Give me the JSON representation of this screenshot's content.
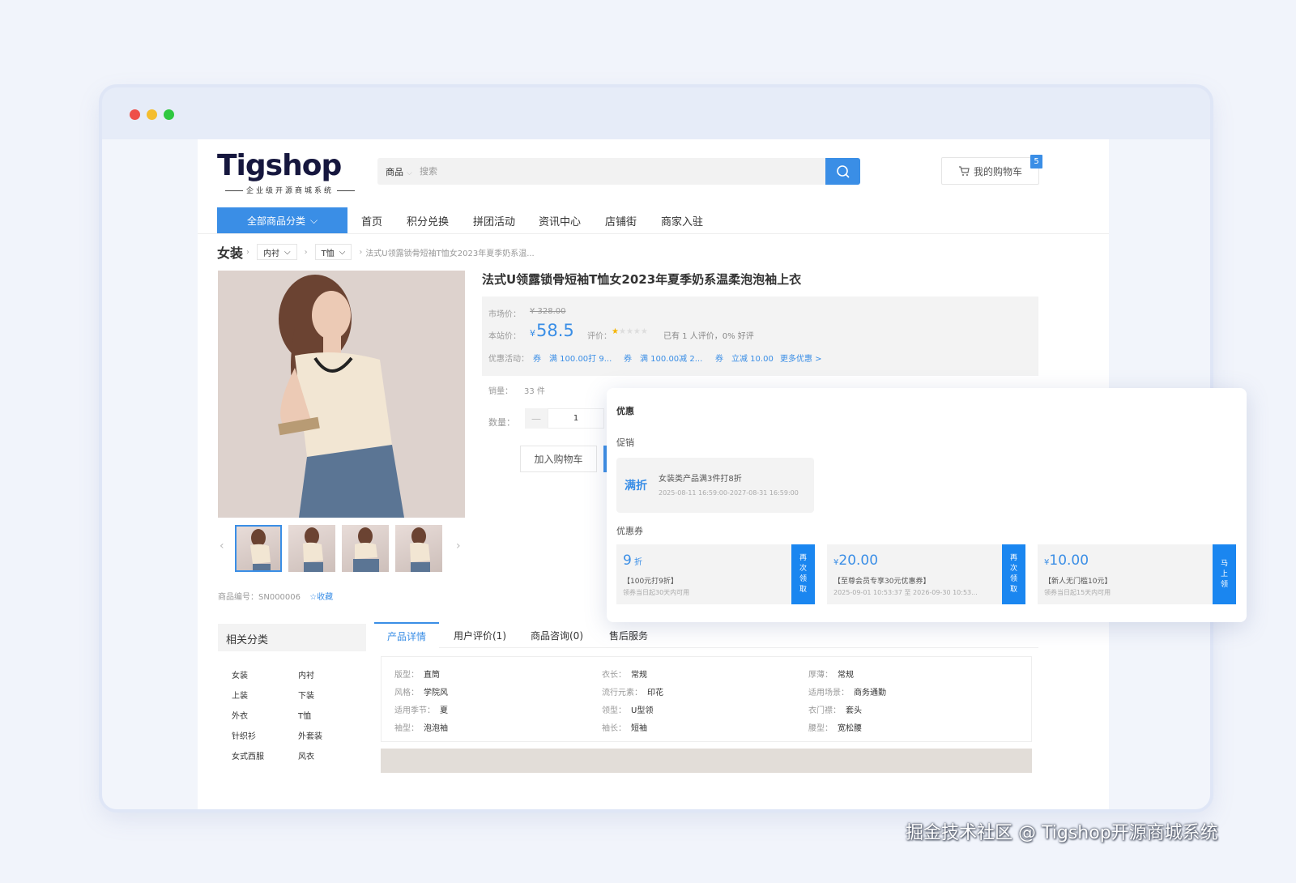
{
  "window": {
    "dots": [
      "#ee4f49",
      "#f4bd2f",
      "#2fc840"
    ]
  },
  "header": {
    "logo": "Tigshop",
    "logo_sub": "企业级开源商城系统",
    "search": {
      "category": "商品",
      "placeholder": "搜索"
    },
    "cart_label": "我的购物车",
    "cart_count": "5"
  },
  "nav": {
    "all_categories": "全部商品分类",
    "items": [
      "首页",
      "积分兑换",
      "拼团活动",
      "资讯中心",
      "店铺街",
      "商家入驻"
    ]
  },
  "breadcrumb": {
    "root": "女装",
    "level1": "内衬",
    "level2": "T恤",
    "current": "法式U领露锁骨短袖T恤女2023年夏季奶系温..."
  },
  "product": {
    "title": "法式U领露锁骨短袖T恤女2023年夏季奶系温柔泡泡袖上衣",
    "market_price_label": "市场价：",
    "market_price": "¥ 328.00",
    "price_label": "本站价：",
    "price_currency": "¥",
    "price": "58.5",
    "rating_label": "评价：",
    "rating_stars": 1,
    "rating_text": "已有 1 人评价，0% 好评",
    "promo_label": "优惠活动：",
    "promos": [
      "券　满 100.00打 9...",
      "券　满 100.00减 2...",
      "券　立减 10.00"
    ],
    "more_promos": "更多优惠 >",
    "sales_label": "销量：",
    "sales": "33 件",
    "qty_label": "数量：",
    "qty": "1",
    "qty_minus": "—",
    "add_cart": "加入购物车",
    "sku_label": "商品编号：",
    "sku": "SN000006",
    "favorite": "收藏"
  },
  "related": {
    "title": "相关分类",
    "items": [
      "女装",
      "内衬",
      "上装",
      "下装",
      "外衣",
      "T恤",
      "针织衫",
      "外套装",
      "女式西服",
      "风衣"
    ]
  },
  "tabs": [
    "产品详情",
    "用户评价(1)",
    "商品咨询(0)",
    "售后服务"
  ],
  "specs": [
    {
      "k": "版型：",
      "v": "直筒"
    },
    {
      "k": "衣长：",
      "v": "常规"
    },
    {
      "k": "厚薄：",
      "v": "常规"
    },
    {
      "k": "风格：",
      "v": "学院风"
    },
    {
      "k": "流行元素：",
      "v": "印花"
    },
    {
      "k": "适用场景：",
      "v": "商务通勤"
    },
    {
      "k": "适用季节：",
      "v": "夏"
    },
    {
      "k": "领型：",
      "v": "U型领"
    },
    {
      "k": "衣门襟：",
      "v": "套头"
    },
    {
      "k": "袖型：",
      "v": "泡泡袖"
    },
    {
      "k": "袖长：",
      "v": "短袖"
    },
    {
      "k": "腰型：",
      "v": "宽松腰"
    }
  ],
  "popup": {
    "title": "优惠",
    "promo_section": "促销",
    "promo": {
      "tag": "满折",
      "text": "女装类产品满3件打8折",
      "date": "2025-08-11 16:59:00-2027-08-31 16:59:00"
    },
    "coupon_section": "优惠券",
    "coupons": [
      {
        "prefix": "",
        "value": "9",
        "unit": " 折",
        "name": "【100元打9折】",
        "note": "领券当日起30天内可用",
        "btn": "再次领取"
      },
      {
        "prefix": "¥",
        "value": "20.00",
        "unit": "",
        "name": "【至尊会员专享30元优惠券】",
        "note": "2025-09-01 10:53:37 至 2026-09-30 10:53...",
        "btn": "再次领取"
      },
      {
        "prefix": "¥",
        "value": "10.00",
        "unit": "",
        "name": "【新人无门槛10元】",
        "note": "领券当日起15天内可用",
        "btn": "马上领"
      }
    ]
  },
  "watermark": "掘金技术社区 @ Tigshop开源商城系统",
  "colors": {
    "accent": "#3a8ee6",
    "star": "#f5b400"
  }
}
